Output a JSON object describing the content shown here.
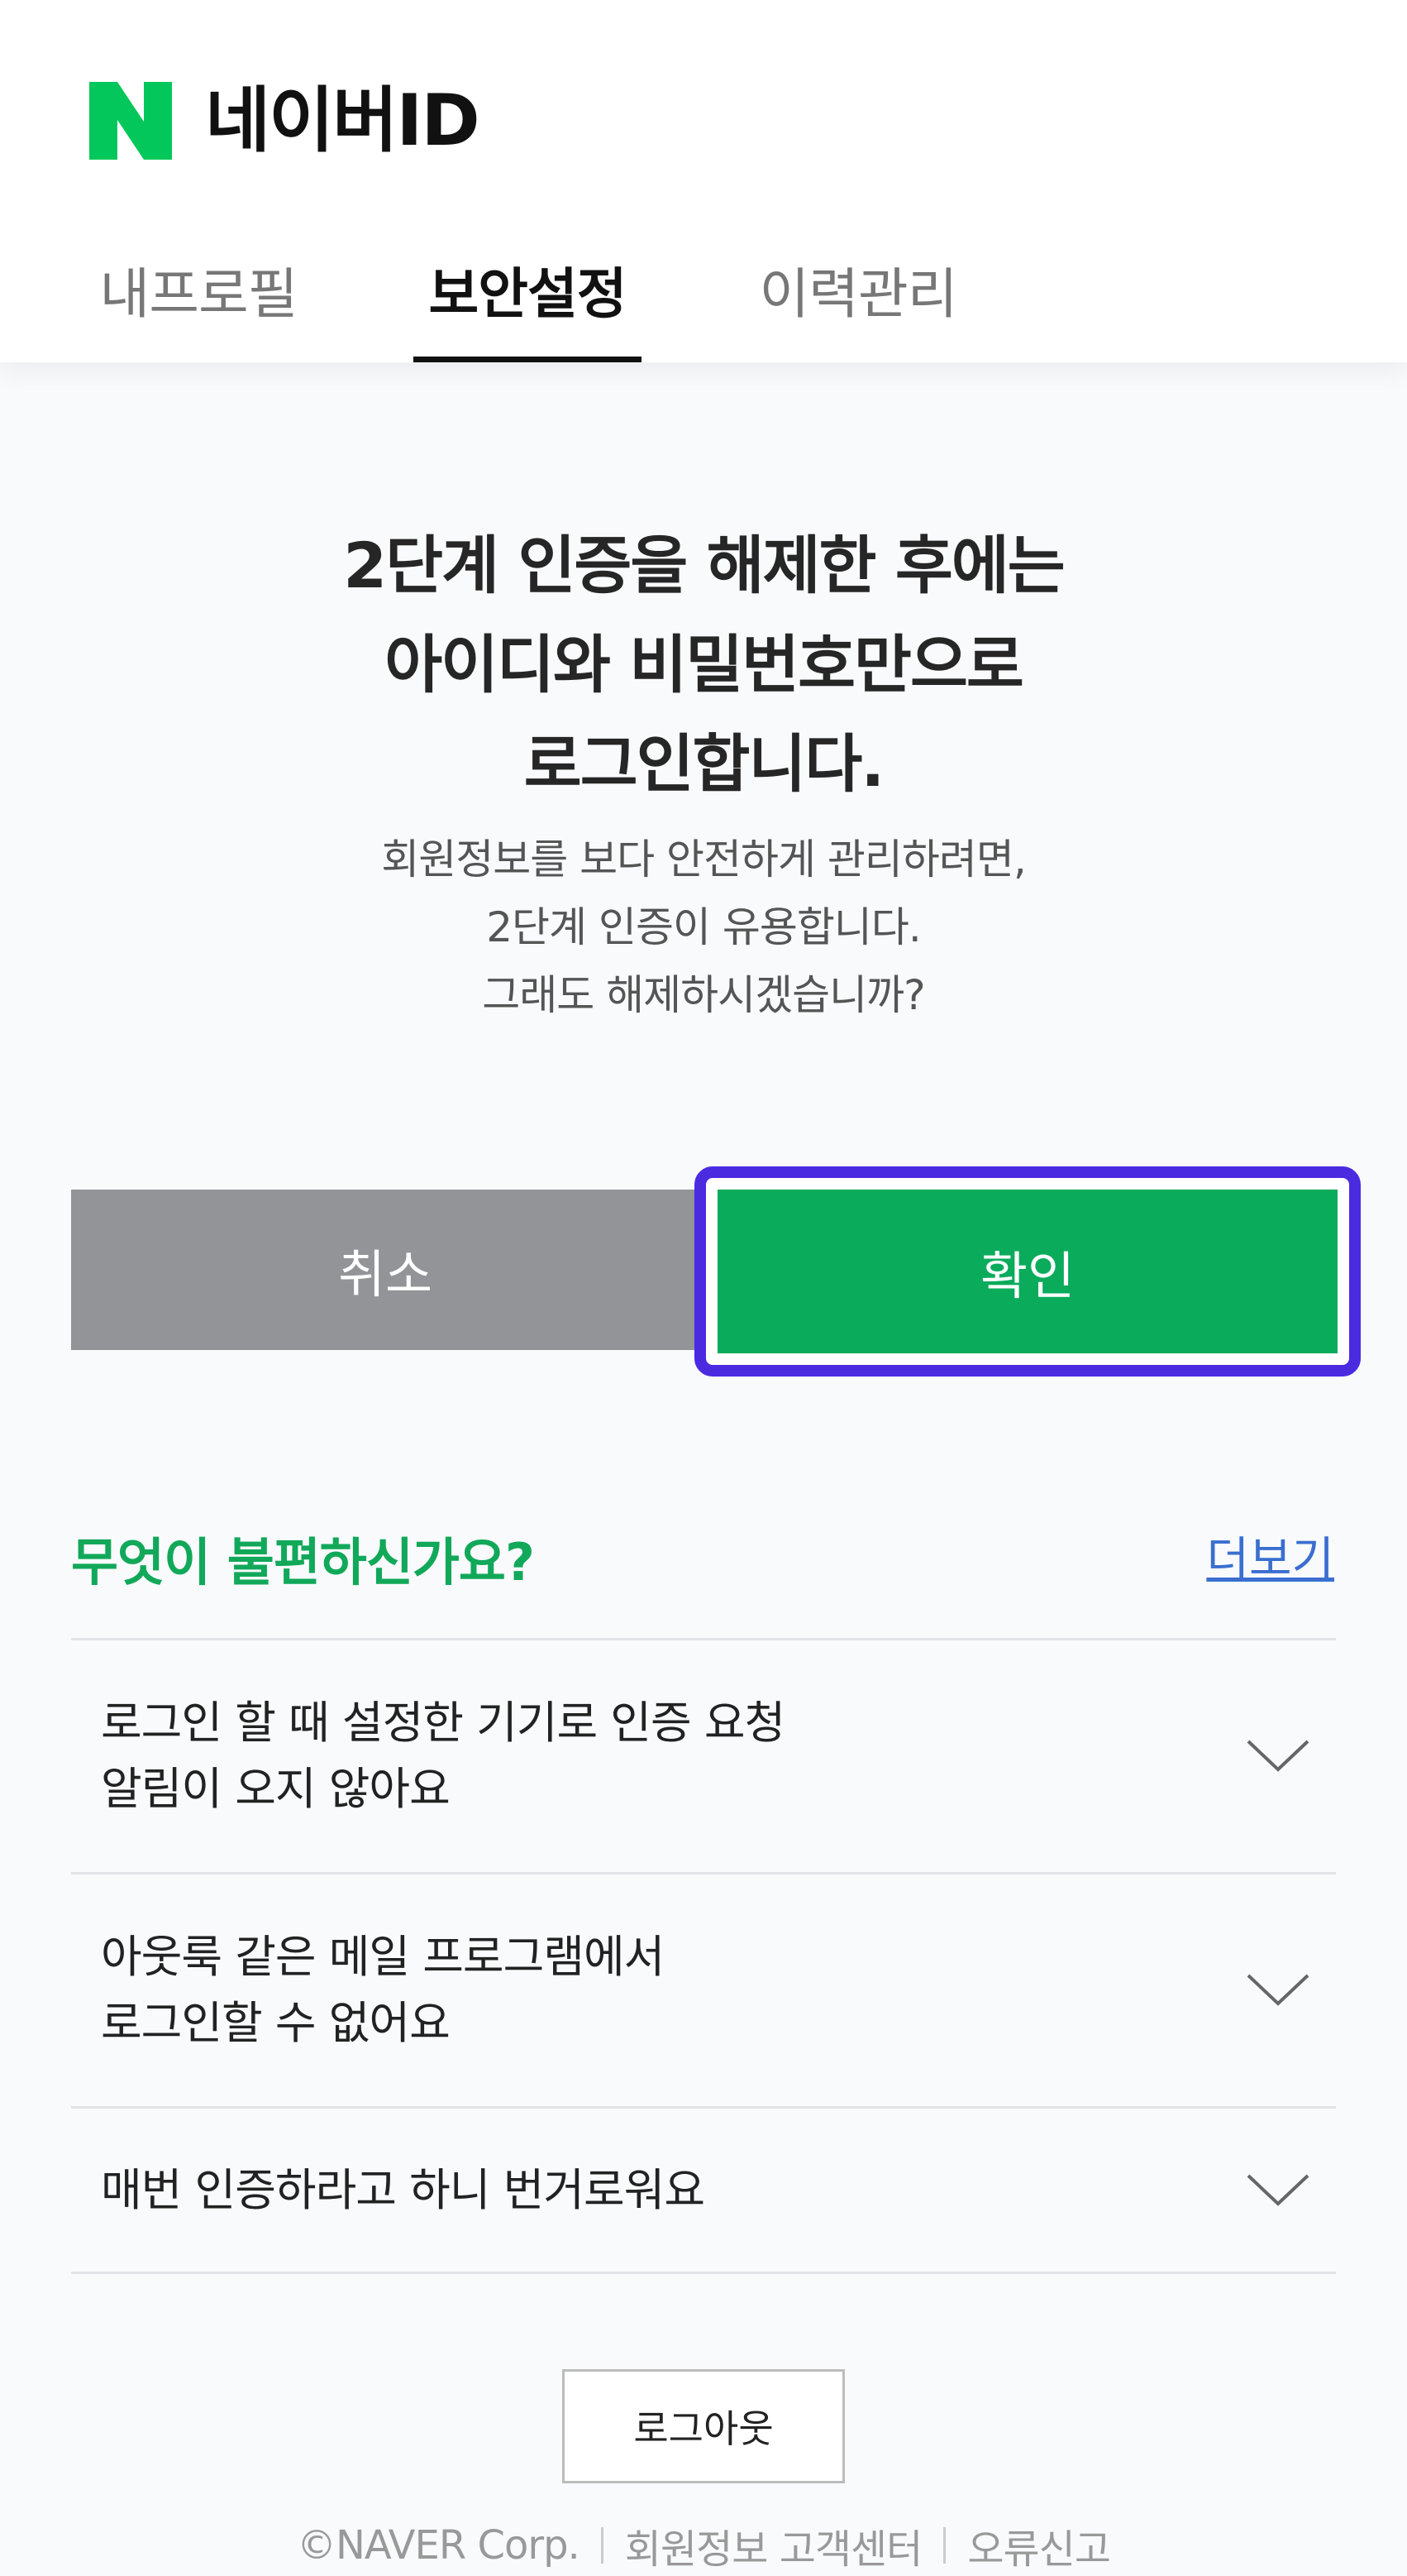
{
  "brand": {
    "logo_letter": "N",
    "title": "네이버ID",
    "accent": "#03c75a"
  },
  "tabs": [
    {
      "label": "내프로필",
      "active": false
    },
    {
      "label": "보안설정",
      "active": true
    },
    {
      "label": "이력관리",
      "active": false
    }
  ],
  "main": {
    "headline": [
      "2단계 인증을 해제한 후에는",
      "아이디와 비밀번호만으로",
      "로그인합니다."
    ],
    "description": [
      "회원정보를 보다 안전하게 관리하려면,",
      "2단계 인증이 유용합니다.",
      "그래도 해제하시겠습니까?"
    ],
    "cancel_label": "취소",
    "confirm_label": "확인"
  },
  "faq": {
    "title": "무엇이 불편하신가요?",
    "more_label": "더보기",
    "items": [
      [
        "로그인 할 때 설정한 기기로 인증 요청",
        "알림이 오지 않아요"
      ],
      [
        "아웃룩 같은 메일 프로그램에서",
        "로그인할 수 없어요"
      ],
      [
        "매번 인증하라고 하니 번거로워요"
      ]
    ]
  },
  "logout_label": "로그아웃",
  "footer": {
    "copyright": "©NAVER Corp.",
    "support": "회원정보 고객센터",
    "report": "오류신고"
  },
  "colors": {
    "confirm_bg": "#0aab5b",
    "cancel_bg": "#929498",
    "focus_ring": "#4a2be0",
    "faq_title": "#11a85a",
    "link": "#3a6fd0"
  },
  "icons": [
    "naver-n-logo-icon",
    "chevron-down-icon"
  ]
}
